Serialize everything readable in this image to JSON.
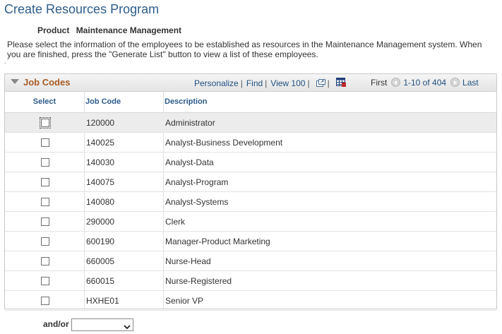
{
  "page": {
    "title": "Create Resources Program",
    "product_label": "Product",
    "product_value": "Maintenance Management",
    "instructions": "Please select the information of the employees to be established as resources in the Maintenance Management system.  When you are finished, press the \"Generate List\" button to view a list of these employees.",
    "dash": "-"
  },
  "grid": {
    "title": "Job Codes",
    "nav": {
      "personalize": "Personalize",
      "find": "Find",
      "view": "View 100",
      "separator": "|"
    },
    "pager": {
      "first": "First",
      "range": "1-10 of 404",
      "last": "Last"
    },
    "columns": {
      "select": "Select",
      "job_code": "Job Code",
      "description": "Description"
    },
    "rows": [
      {
        "code": "120000",
        "desc": "Administrator"
      },
      {
        "code": "140025",
        "desc": "Analyst-Business Development"
      },
      {
        "code": "140030",
        "desc": "Analyst-Data"
      },
      {
        "code": "140075",
        "desc": "Analyst-Program"
      },
      {
        "code": "140080",
        "desc": "Analyst-Systems"
      },
      {
        "code": "290000",
        "desc": "Clerk"
      },
      {
        "code": "600190",
        "desc": "Manager-Product Marketing"
      },
      {
        "code": "660005",
        "desc": "Nurse-Head"
      },
      {
        "code": "660015",
        "desc": "Nurse-Registered"
      },
      {
        "code": "HXHE01",
        "desc": "Senior VP"
      }
    ]
  },
  "andor": {
    "label": "and/or",
    "selected": ""
  },
  "icons": {
    "collapse": "collapse-triangle-icon",
    "new_window": "new-window-icon",
    "spreadsheet": "spreadsheet-download-icon",
    "prev": "previous-page-icon",
    "next": "next-page-icon",
    "dropdown": "chevron-down-icon"
  }
}
